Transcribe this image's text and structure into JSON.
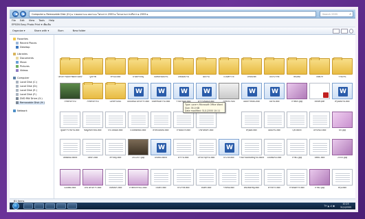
{
  "window": {
    "path": "Computer  ▸  Removable Disk (H:)  ▸  รวมผลงาน  ▸  ผลงาน  ▸  โครงการ 2555  ▸  โครงงานการบริหาร  ▸  2555  ▸",
    "search_placeholder": "Search 2555"
  },
  "menu": {
    "items": [
      "File",
      "Edit",
      "View",
      "Tools",
      "Help"
    ],
    "row2": "EPSON Easy Photo Print  ▾   เพิ่มเติม"
  },
  "toolbar": {
    "organize": "Organize ▾",
    "share": "Share with ▾",
    "burn": "Burn",
    "newfolder": "New folder"
  },
  "nav": {
    "favorites": "Favorites",
    "recent": "Recent Places",
    "desktop": "Desktop",
    "libraries": "Libraries",
    "documents": "Documents",
    "music": "Music",
    "pictures": "Pictures",
    "videos": "Videos",
    "computer": "Computer",
    "drives": [
      "Local Disk (C:)",
      "Local Disk (D:)",
      "Local Disk (E:)",
      "Local Disk (F:)",
      "DVD RW Drive (G:)",
      "Removable Disk (H:)"
    ],
    "network": "Network"
  },
  "files": {
    "row1": [
      "โครงการสุขภาพดีถ้วนหน้า",
      "รูปภาพ",
      "สำรองไฟล์",
      "ป้ายคำขวัญ",
      "ใบสมัครผลงาน",
      "แฟ้มผลงาน",
      "ผลงาน",
      "แบบสำรวจ",
      "ป้ายนิเทศ",
      "ใบประกาศ",
      "หนังสือ",
      "ไฟล์เก่า",
      "รายงาน"
    ],
    "row2": [
      "ภาพกิจกรรม",
      "ภาพกิจกรรม",
      "เอกสารแนบ",
      "แบบเสนอโครงการ.doc",
      "บันทึกข้อความ.doc",
      "รายงานผล.doc",
      "ตารางข้อมูล.doc",
      "ภาพประกอบ",
      "แผนการสอน.doc",
      "ใบงาน.doc",
      "ภาพปก.jpg",
      "cover.pdf",
      "สรุปผลงาน.doc",
      "ภาพรวม.jpg"
    ],
    "row3": [
      "คู่มือการใช้งาน.doc",
      "ข้อมูลนักเรียน.doc",
      "ประเมินผล.doc",
      "แบบทดสอบ.doc",
      "คำสั่งแต่งตั้ง.doc",
      "ภาคผนวก.doc",
      "เกียรติบัตร.doc",
      "สรุปผล.doc",
      "แผนงาน.doc",
      "QR.docx",
      "ใบรับรอง.doc",
      "ปก.jpg"
    ],
    "row4": [
      "บทคัดย่อ.docx",
      "บทนำ.doc",
      "สารบัญ.doc",
      "201207.jpg",
      "ปกหลัง.docx",
      "ตาราง.doc",
      "บรรณานุกรม.doc",
      "ประวัติ.doc",
      "รายงานฉบับสมบูรณ์.docx",
      "แบบฟอร์ม.doc",
      "ภาพ1.jpg",
      "บทที่1.doc",
      "บทที่2.doc",
      "2555.jpg"
    ],
    "row5": [
      "แผ่นพับ.doc",
      "ป้ายโครงการ.doc",
      "โปสเตอร์.doc",
      "ภาพกิจกรรม2.doc",
      "ใบปลิว.doc",
      "ประกาศ.doc",
      "บันทึก.doc",
      "รายชื่อ.doc",
      "หนังสือเชิญ.doc",
      "คำกล่าว.doc",
      "กำหนดการ.doc",
      "ภาพ2.jpg",
      "สรุป.doc"
    ]
  },
  "tooltip": {
    "line1": "Type: เอกสาร Microsoft Office Word",
    "line2": "Size: 35.0 KB",
    "line3": "Date modified: 31/1/2555 10:11"
  },
  "statusbar": {
    "count": "81 items"
  },
  "taskbar": {
    "tray": "TH  ▲  ◂)  ▣",
    "time": "10:25",
    "date": "31/1/2555"
  }
}
